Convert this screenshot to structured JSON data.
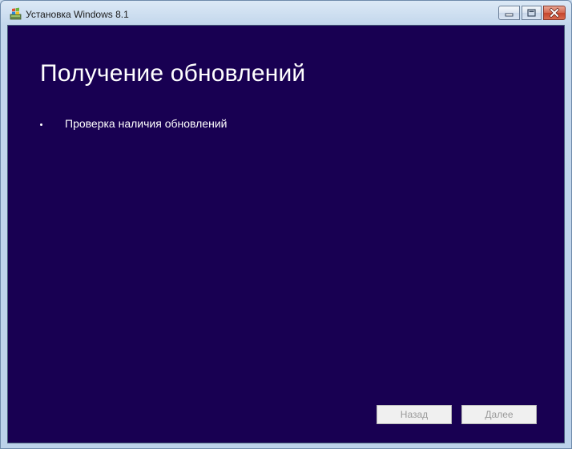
{
  "window": {
    "title": "Установка Windows 8.1",
    "icons": {
      "app": "windows-setup-icon",
      "minimize": "minimize-icon",
      "maximize": "maximize-icon",
      "close": "close-icon"
    }
  },
  "page": {
    "heading": "Получение обновлений",
    "status_items": [
      {
        "label": "Проверка наличия обновлений"
      }
    ]
  },
  "footer": {
    "back_label": "Назад",
    "next_label": "Далее",
    "back_enabled": false,
    "next_enabled": false
  },
  "colors": {
    "background": "#180052",
    "text": "#ffffff",
    "button_disabled_text": "#9a9a9a"
  }
}
